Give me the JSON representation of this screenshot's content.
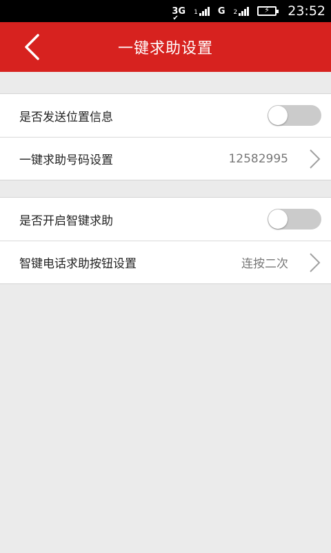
{
  "status_bar": {
    "network_label": "3G",
    "signal2_label": "G",
    "signal3_label": "2",
    "time": "23:52"
  },
  "app_bar": {
    "title": "一键求助设置",
    "back_icon": "chevron-left-icon",
    "background_color": "#d7221f"
  },
  "groups": [
    {
      "rows": [
        {
          "label": "是否发送位置信息",
          "type": "toggle",
          "on": false
        },
        {
          "label": "一键求助号码设置",
          "type": "link",
          "value": "12582995"
        }
      ]
    },
    {
      "rows": [
        {
          "label": "是否开启智键求助",
          "type": "toggle",
          "on": false
        },
        {
          "label": "智键电话求助按钮设置",
          "type": "link",
          "value": "连按二次"
        }
      ]
    }
  ]
}
